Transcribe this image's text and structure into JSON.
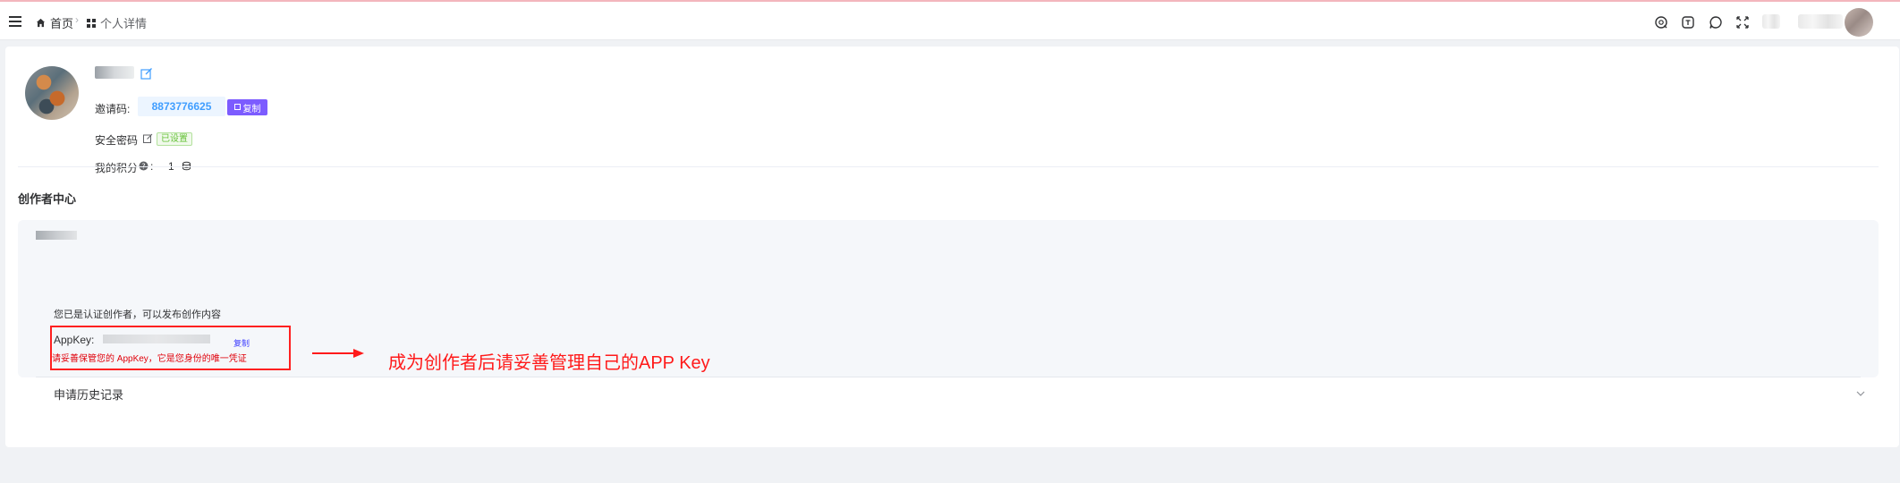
{
  "header": {
    "breadcrumb": {
      "home": "首页",
      "current": "个人详情"
    },
    "right_icons": [
      "search-icon",
      "sticky-note-icon",
      "chat-bubble-icon",
      "fullscreen-icon"
    ]
  },
  "profile": {
    "invite_label": "邀请码:",
    "invite_code": "8873776625",
    "copy_label": "复制",
    "security_label": "安全密码",
    "security_status": "已设置",
    "points_label": "我的积分",
    "points_suffix": ":",
    "points_value": "1"
  },
  "creator": {
    "section_title": "创作者中心",
    "certified_text": "您已是认证创作者，可以发布创作内容",
    "appkey_label": "AppKey:",
    "appkey_copy": "复制",
    "appkey_warning": "请妥善保管您的 AppKey，它是您身份的唯一凭证",
    "history_label": "申请历史记录"
  },
  "annotation": {
    "text": "成为创作者后请妥善管理自己的APP Key",
    "color": "#ff1a1a"
  },
  "colors": {
    "accent_blue": "#409eff",
    "purple_button": "#7c5cff",
    "success_green": "#67c23a",
    "warning_red": "#e0000a"
  }
}
